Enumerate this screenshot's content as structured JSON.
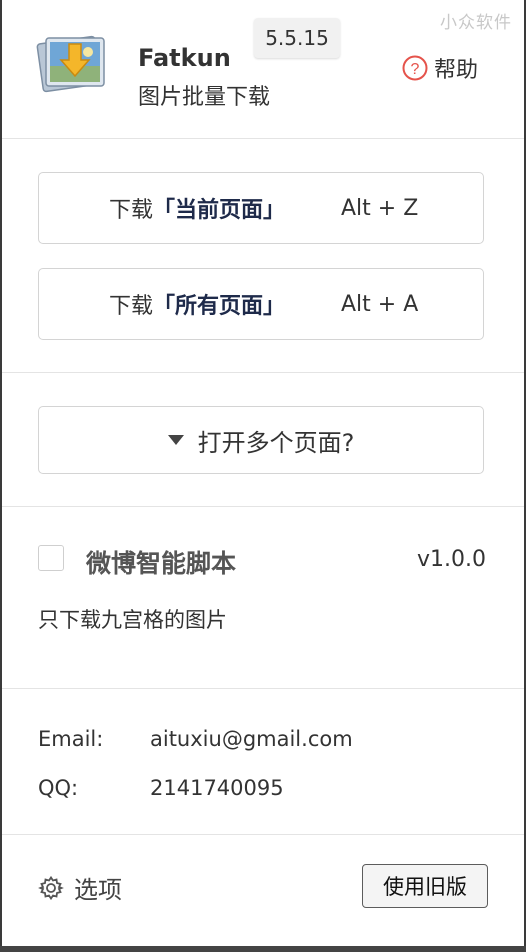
{
  "watermark": "小众软件",
  "header": {
    "app_name": "Fatkun",
    "app_subtitle": "图片批量下载",
    "version": "5.5.15",
    "help_label": "帮助"
  },
  "downloads": {
    "current": {
      "prefix": "下载",
      "quote": "「当前页面」",
      "shortcut": "Alt + Z"
    },
    "all": {
      "prefix": "下载",
      "quote": "「所有页面」",
      "shortcut": "Alt + A"
    },
    "multi_label": "打开多个页面?"
  },
  "script": {
    "title": "微博智能脚本",
    "version": "v1.0.0",
    "description": "只下载九宫格的图片",
    "checked": false
  },
  "contact": {
    "email_label": "Email:",
    "email_value": "aituxiu@gmail.com",
    "qq_label": "QQ:",
    "qq_value": "2141740095"
  },
  "footer": {
    "options_label": "选项",
    "old_version_label": "使用旧版"
  },
  "colors": {
    "accent_dark": "#1e2a4a",
    "help_icon_red": "#e5534b",
    "border": "#d4d4d4"
  }
}
